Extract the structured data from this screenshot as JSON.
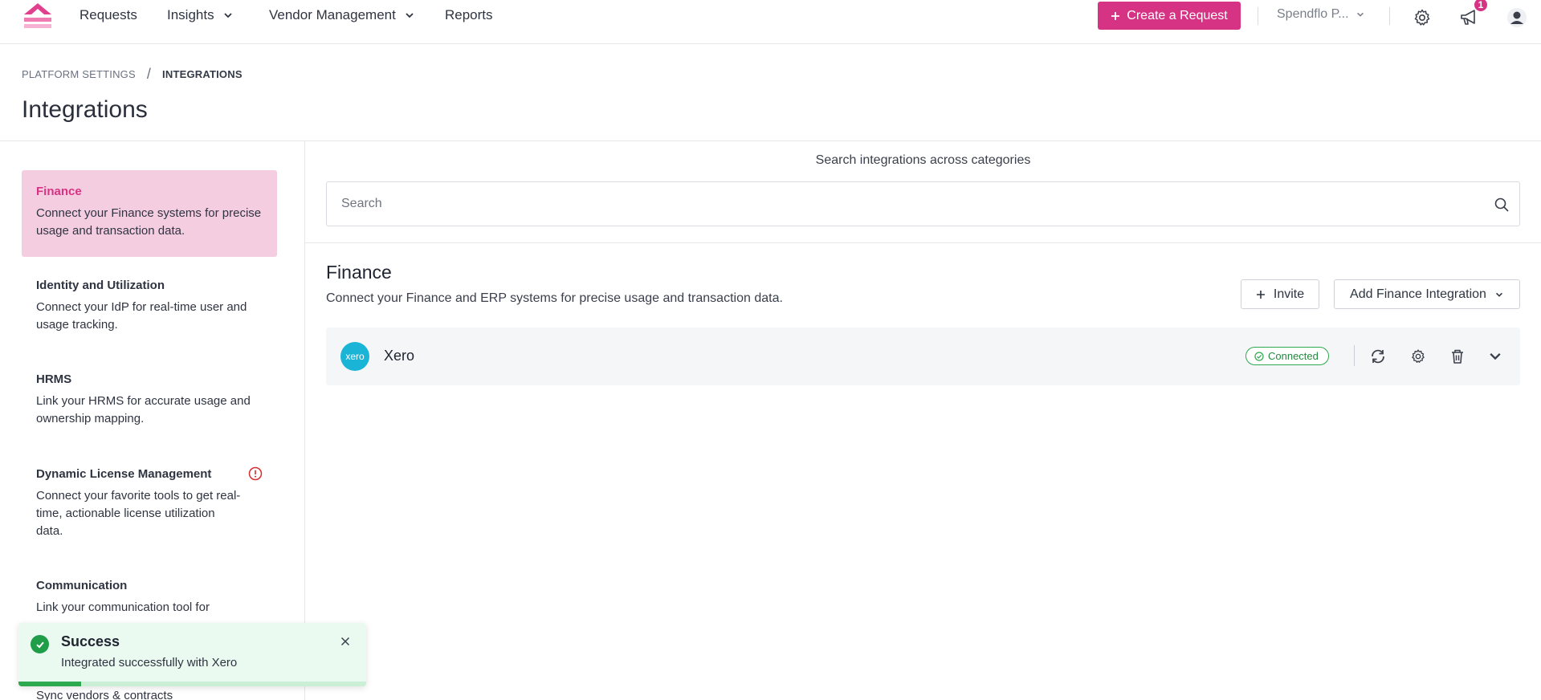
{
  "nav": {
    "items": [
      {
        "label": "Requests",
        "has_dropdown": false
      },
      {
        "label": "Insights",
        "has_dropdown": true
      },
      {
        "label": "Vendor Management",
        "has_dropdown": true
      },
      {
        "label": "Reports",
        "has_dropdown": false
      }
    ],
    "create_button": "+ Create a Request",
    "create_label": "Create a Request",
    "org_name": "Spendflo P...",
    "notification_count": "1",
    "accent_color": "#d63384"
  },
  "breadcrumb": {
    "parent": "PLATFORM SETTINGS",
    "separator": "/",
    "current": "INTEGRATIONS"
  },
  "page_title": "Integrations",
  "sidebar": {
    "items": [
      {
        "title": "Finance",
        "desc": "Connect your Finance systems for precise usage and transaction data.",
        "active": true
      },
      {
        "title": "Identity and Utilization",
        "desc": "Connect your IdP for real-time user and usage tracking.",
        "active": false
      },
      {
        "title": "HRMS",
        "desc": "Link your HRMS for accurate usage and ownership mapping.",
        "active": false
      },
      {
        "title": "Dynamic License Management",
        "desc": "Connect your favorite tools to get real-time, actionable license utilization data.",
        "active": false,
        "warning": true
      },
      {
        "title": "Communication",
        "desc": "Link your communication tool for",
        "active": false
      }
    ],
    "peek_text": "Sync vendors & contracts"
  },
  "search": {
    "label": "Search integrations across categories",
    "placeholder": "Search",
    "value": ""
  },
  "section": {
    "title": "Finance",
    "desc": "Connect your Finance and ERP systems for precise usage and transaction data.",
    "invite_label": "Invite",
    "add_label": "Add Finance Integration"
  },
  "integrations": [
    {
      "logo_text": "xero",
      "name": "Xero",
      "status": "Connected",
      "status_color": "#2da94f"
    }
  ],
  "toast": {
    "title": "Success",
    "message": "Integrated successfully with Xero",
    "progress": 0.18
  }
}
